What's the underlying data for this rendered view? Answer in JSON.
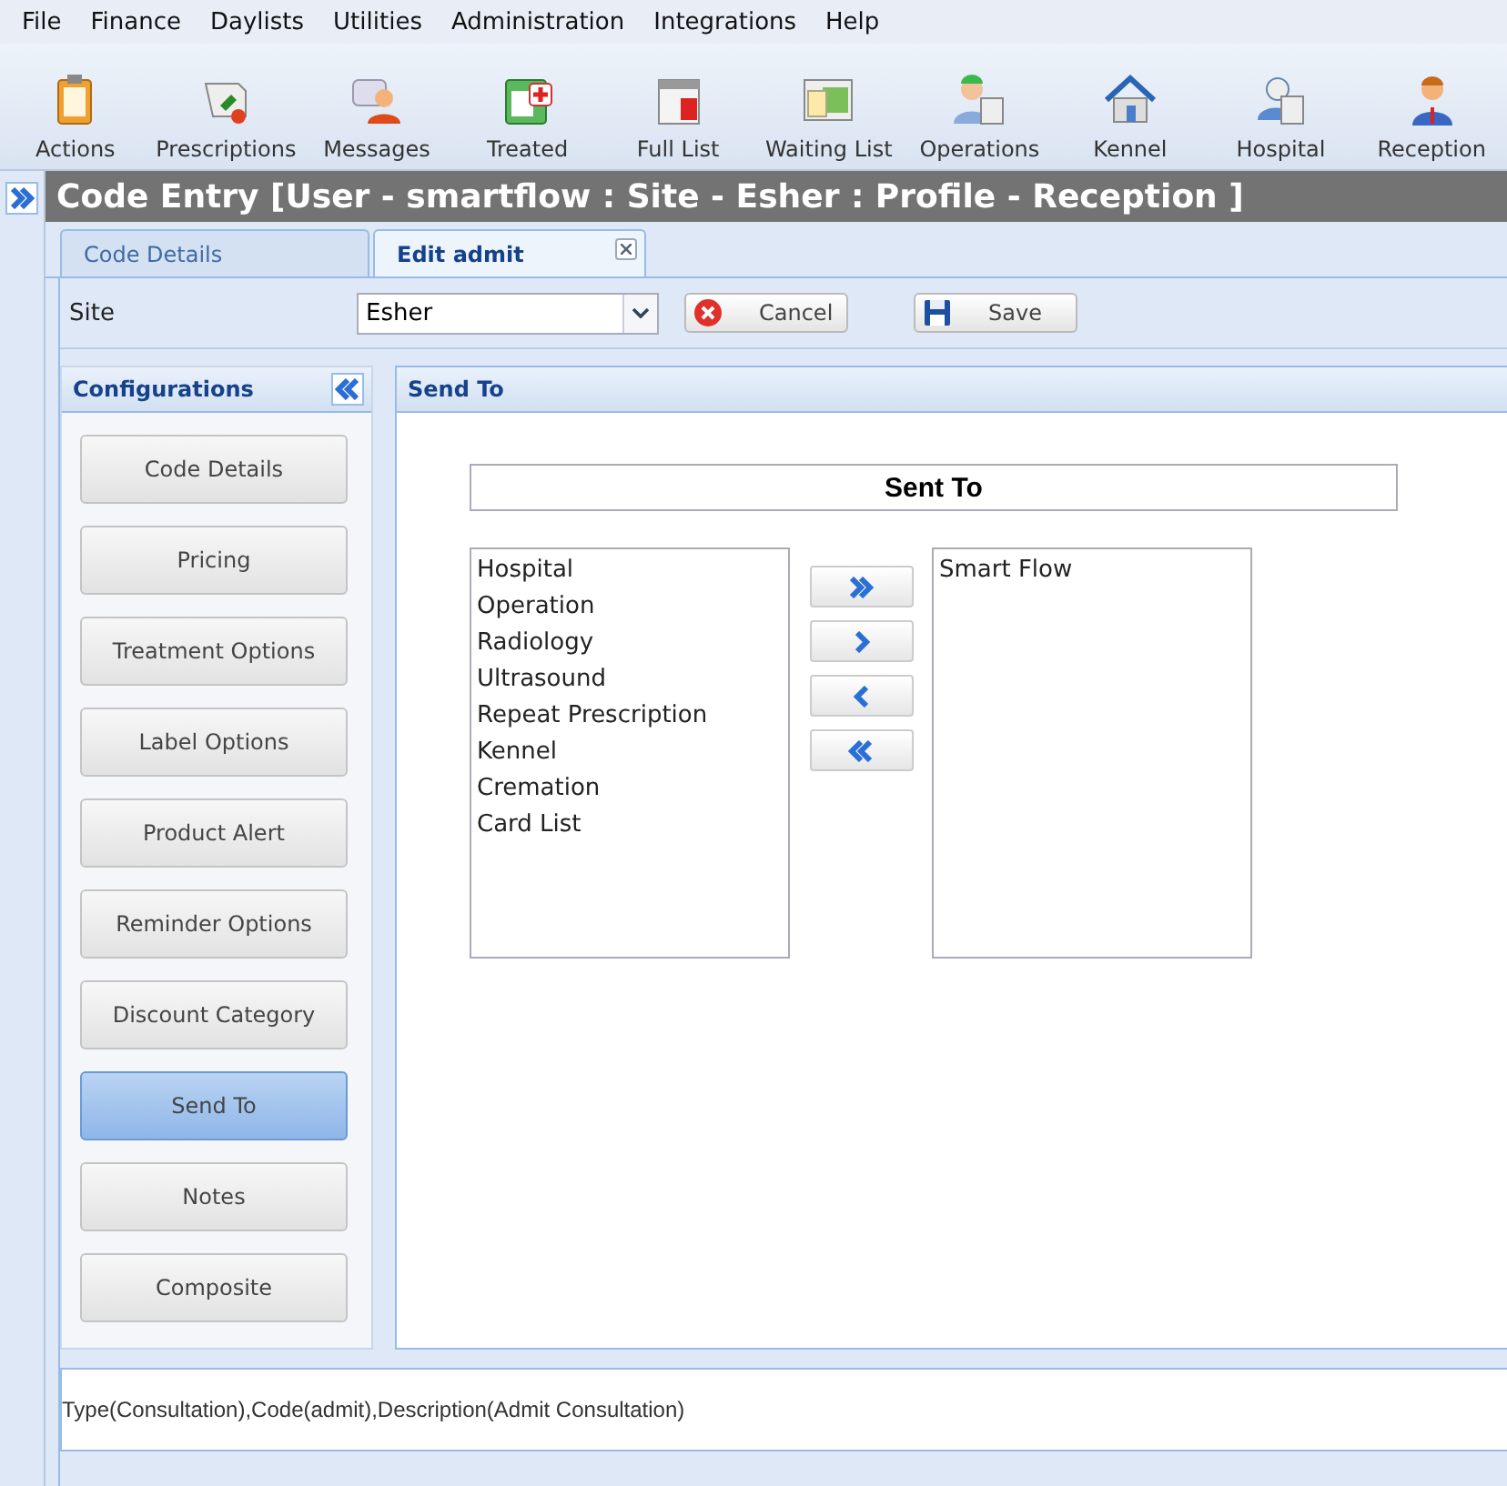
{
  "menu": [
    "File",
    "Finance",
    "Daylists",
    "Utilities",
    "Administration",
    "Integrations",
    "Help"
  ],
  "toolbar": [
    "Actions",
    "Prescriptions",
    "Messages",
    "Treated",
    "Full List",
    "Waiting List",
    "Operations",
    "Kennel",
    "Hospital",
    "Reception"
  ],
  "window": {
    "title": "Code Entry [User - smartflow : Site - Esher : Profile - Reception ]"
  },
  "tabs": [
    {
      "label": "Code Details",
      "selected": false,
      "closable": false
    },
    {
      "label": "Edit admit",
      "selected": true,
      "closable": true
    }
  ],
  "site": {
    "label": "Site",
    "value": "Esher"
  },
  "buttons": [
    {
      "kind": "cancel",
      "label": "Cancel"
    },
    {
      "kind": "save",
      "label": "Save"
    }
  ],
  "configurations": {
    "title": "Configurations",
    "items": [
      {
        "label": "Code Details",
        "selected": false
      },
      {
        "label": "Pricing",
        "selected": false
      },
      {
        "label": "Treatment Options",
        "selected": false
      },
      {
        "label": "Label Options",
        "selected": false
      },
      {
        "label": "Product Alert",
        "selected": false
      },
      {
        "label": "Reminder Options",
        "selected": false
      },
      {
        "label": "Discount Category",
        "selected": false
      },
      {
        "label": "Send To",
        "selected": true
      },
      {
        "label": "Notes",
        "selected": false
      },
      {
        "label": "Composite",
        "selected": false
      }
    ]
  },
  "send_to": {
    "title": "Send To",
    "heading": "Sent To",
    "available": [
      "Hospital",
      "Operation",
      "Radiology",
      "Ultrasound",
      "Repeat Prescription",
      "Kennel",
      "Cremation",
      "Card List"
    ],
    "selected_items": [
      "Smart Flow"
    ]
  },
  "status_text": "Type(Consultation),Code(admit),Description(Admit Consultation)"
}
